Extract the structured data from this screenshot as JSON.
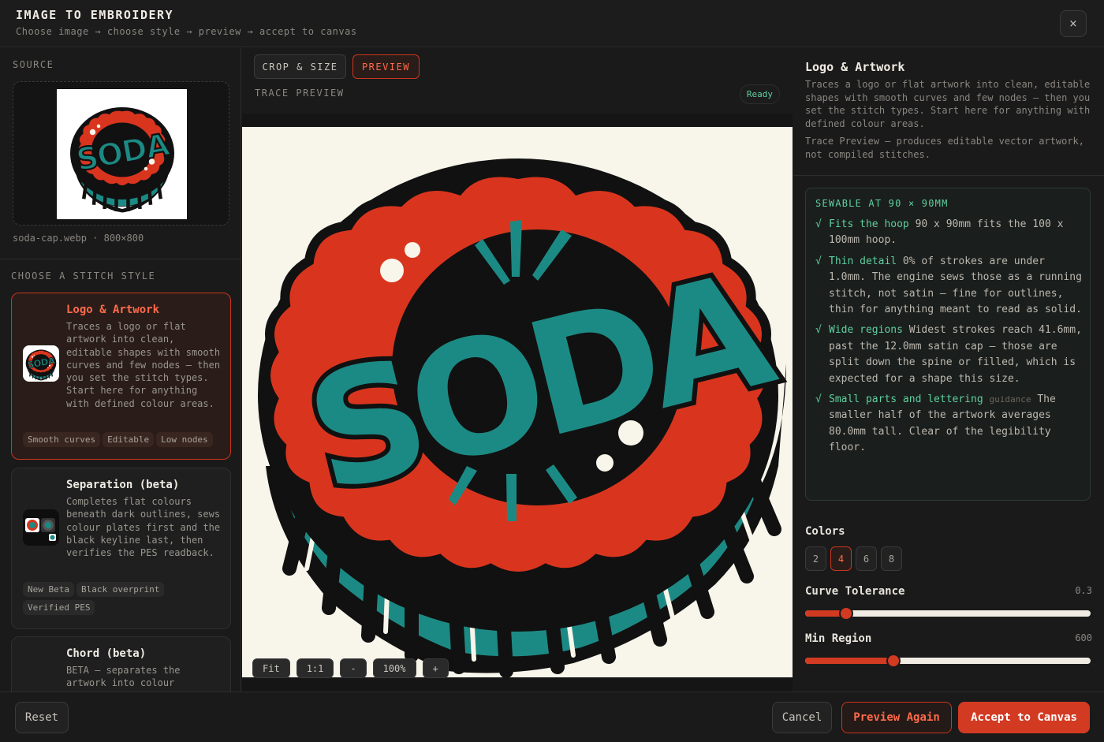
{
  "header": {
    "title": "IMAGE TO EMBROIDERY",
    "subtitle": "Choose image → choose style → preview → accept to canvas",
    "close": "×"
  },
  "source": {
    "label": "SOURCE",
    "meta": "soda-cap.webp · 800×800"
  },
  "styles": {
    "label": "CHOOSE A STITCH STYLE",
    "items": [
      {
        "title": "Logo & Artwork",
        "desc": "Traces a logo or flat artwork into clean, editable shapes with smooth curves and few nodes — then you set the stitch types. Start here for anything with defined colour areas.",
        "tags": [
          "Smooth curves",
          "Editable",
          "Low nodes"
        ]
      },
      {
        "title": "Separation (beta)",
        "desc": "Completes flat colours beneath dark outlines, sews colour plates first and the black keyline last, then verifies the PES readback.",
        "tags": [
          "New Beta",
          "Black overprint",
          "Verified PES"
        ]
      },
      {
        "title": "Chord (beta)",
        "desc": "BETA — separates the artwork into colour",
        "tags": []
      }
    ]
  },
  "center": {
    "tab_crop": "CROP & SIZE",
    "tab_preview": "PREVIEW",
    "trace_label": "TRACE PREVIEW",
    "status": "Ready",
    "artwork_text": "SODA",
    "zoom": {
      "fit": "Fit",
      "one_to_one": "1:1",
      "minus": "-",
      "level": "100%",
      "plus": "+"
    }
  },
  "right": {
    "title": "Logo & Artwork",
    "desc": "Traces a logo or flat artwork into clean, editable shapes with smooth curves and few nodes — then you set the stitch types. Start here for anything with defined colour areas.",
    "note": "Trace Preview — produces editable vector artwork, not compiled stitches.",
    "sewable": {
      "heading": "SEWABLE AT 90 × 90MM",
      "items": [
        {
          "check": "√",
          "key": "Fits the hoop",
          "text": "90 x 90mm fits the 100 x 100mm hoop.",
          "guide": ""
        },
        {
          "check": "√",
          "key": "Thin detail",
          "text": "0% of strokes are under 1.0mm. The engine sews those as a running stitch, not satin — fine for outlines, thin for anything meant to read as solid.",
          "guide": ""
        },
        {
          "check": "√",
          "key": "Wide regions",
          "text": "Widest strokes reach 41.6mm, past the 12.0mm satin cap — those are split down the spine or filled, which is expected for a shape this size.",
          "guide": ""
        },
        {
          "check": "√",
          "key": "Small parts and lettering",
          "text": "The smaller half of the artwork averages 80.0mm tall. Clear of the legibility floor.",
          "guide": "guidance"
        }
      ]
    },
    "colors": {
      "label": "Colors",
      "options": [
        "2",
        "4",
        "6",
        "8"
      ],
      "selected": "4"
    },
    "curve_tolerance": {
      "label": "Curve Tolerance",
      "value": "0.3",
      "fraction": 0.145
    },
    "min_region": {
      "label": "Min Region",
      "value": "600",
      "fraction": 0.31
    }
  },
  "footer": {
    "reset": "Reset",
    "cancel": "Cancel",
    "preview_again": "Preview Again",
    "accept": "Accept to Canvas"
  },
  "palette": {
    "accent": "#d33a22",
    "teal": "#1c8a84",
    "red": "#d9351e",
    "cream": "#f8f5ea",
    "ok": "#5ed0a0"
  }
}
